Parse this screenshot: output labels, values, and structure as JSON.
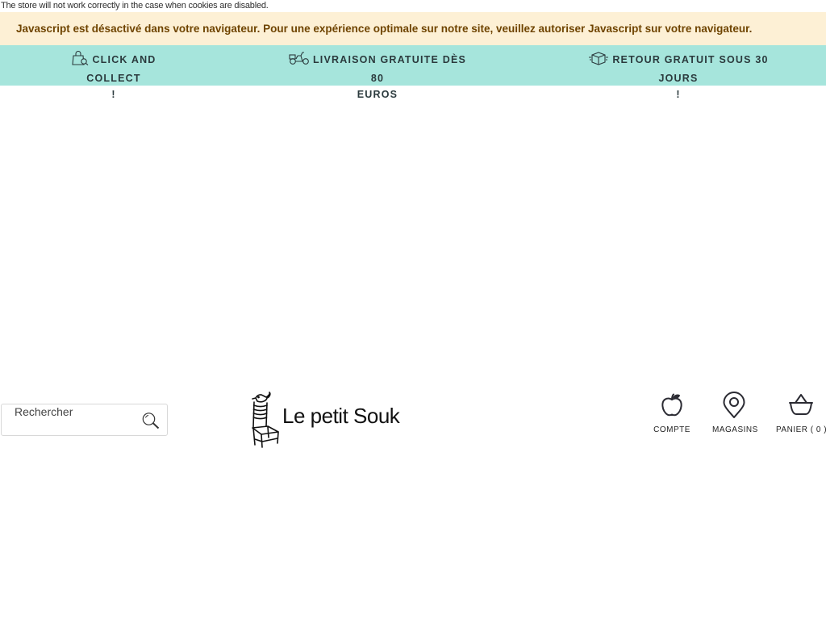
{
  "notices": {
    "cookies": "The store will not work correctly in the case when cookies are disabled.",
    "javascript": "Javascript est désactivé dans votre navigateur. Pour une expérience optimale sur notre site, veuillez autoriser Javascript sur votre navigateur."
  },
  "promo_bar": {
    "items": [
      {
        "icon": "shopping-bag-icon",
        "line1": "CLICK AND COLLECT",
        "line2": "!"
      },
      {
        "icon": "scooter-icon",
        "line1": "LIVRAISON GRATUITE DÈS 80",
        "line2": "EUROS"
      },
      {
        "icon": "package-return-icon",
        "line1": "RETOUR GRATUIT SOUS 30 JOURS",
        "line2": "!"
      }
    ],
    "background": "#a6e5dc"
  },
  "search": {
    "placeholder": "Rechercher",
    "icon": "magnifier-icon"
  },
  "logo": {
    "text": "Le petit Souk",
    "icon": "chair-bird-logo"
  },
  "header_links": {
    "account": {
      "label": "COMPTE",
      "icon": "apple-icon"
    },
    "stores": {
      "label": "MAGASINS",
      "icon": "map-pin-icon"
    },
    "cart": {
      "label": "PANIER ( 0 )",
      "icon": "basket-icon"
    }
  },
  "colors": {
    "js_notice_bg": "#fdf0d5",
    "js_notice_text": "#6f4400"
  }
}
